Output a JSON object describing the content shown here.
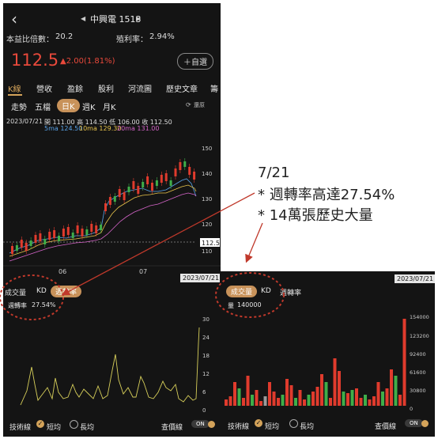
{
  "header": {
    "back_icon": "chevron-left-icon",
    "prev_icon": "triangle-left-icon",
    "next_icon": "triangle-right-icon",
    "stock_name": "中興電 1513"
  },
  "ratios": {
    "pe_label": "本益比倍數：",
    "pe_value": "20.2",
    "yield_label": "殖利率：",
    "yield_value": "2.94%"
  },
  "price": {
    "last": "112.5",
    "change": "▲2.00(1.81%)",
    "watch_label": "＋自選"
  },
  "tabs": [
    "K線",
    "營收",
    "盈餘",
    "股利",
    "河流圖",
    "歷史文章",
    "籌"
  ],
  "periods": [
    "走勢",
    "五檔",
    "日K",
    "週K",
    "月K"
  ],
  "reset_label": "還原",
  "ohlc": {
    "date": "2023/07/21",
    "text": "開 111.00 高 114.50 低 106.00 收 112.50"
  },
  "ma": {
    "ma5": "5ma 124.50",
    "ma10": "10ma 129.30",
    "ma20": "20ma 131.00"
  },
  "price_axis": [
    "150",
    "140",
    "130",
    "120",
    "110"
  ],
  "price_tag": "112.5",
  "months": [
    "06",
    "07"
  ],
  "date_tag": "2023/07/21",
  "indicator_tabs": [
    "成交量",
    "KD",
    "週轉率"
  ],
  "turnover": {
    "label": "週轉率",
    "value": "27.54%",
    "axis": [
      "30",
      "24",
      "18",
      "12",
      "6",
      "0"
    ]
  },
  "volume": {
    "label": "量",
    "value": "140000",
    "axis": [
      "154000",
      "123200",
      "92400",
      "61600",
      "30800",
      "0"
    ]
  },
  "footer": {
    "tech_label": "技術線",
    "short_label": "短均",
    "long_label": "長均",
    "price_lookup_label": "查價線",
    "toggle": "ON"
  },
  "annotation": {
    "date": "7/21",
    "line1": "* 週轉率高達27.54%",
    "line2": "* 14萬張歷史大量"
  },
  "colors": {
    "up": "#e03b2d",
    "down": "#3fae49",
    "accent": "#c8925a",
    "annotation": "#c0392b"
  }
}
